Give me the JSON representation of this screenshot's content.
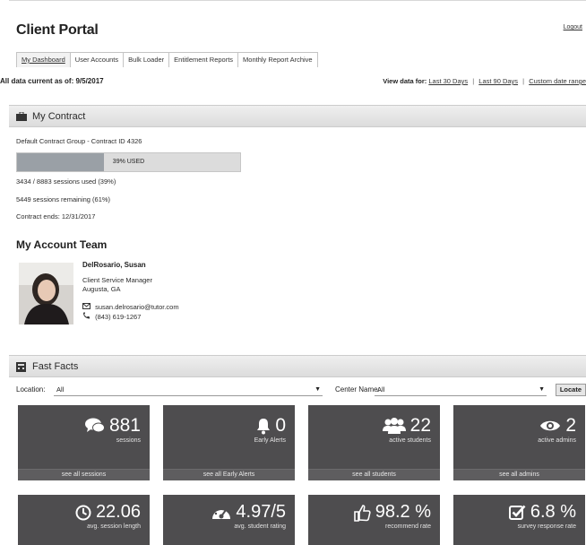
{
  "app": {
    "title": "Client Portal",
    "logout_label": "Logout"
  },
  "tabs": [
    {
      "label": "My Dashboard",
      "active": true
    },
    {
      "label": "User Accounts"
    },
    {
      "label": "Bulk Loader"
    },
    {
      "label": "Entitlement Reports"
    },
    {
      "label": "Monthly Report Archive"
    }
  ],
  "data_current": "All data current as of: 9/5/2017",
  "view_data": {
    "label": "View data for:",
    "options": [
      "Last 30 Days",
      "Last 90 Days",
      "Custom date range"
    ]
  },
  "contract": {
    "header": "My Contract",
    "group_line": "Default Contract Group - Contract ID 4326",
    "progress_label": "39% USED",
    "progress_fraction": 0.39,
    "sessions_used": "3434 / 8883 sessions used (39%)",
    "sessions_remaining": "5449 sessions remaining (61%)",
    "contract_ends": "Contract ends: 12/31/2017"
  },
  "team": {
    "title": "My Account Team",
    "name": "DelRosario, Susan",
    "role": "Client Service Manager",
    "location": "Augusta, GA",
    "email": "susan.delrosario@tutor.com",
    "phone": "(843) 619-1267"
  },
  "fast_facts": {
    "header": "Fast Facts",
    "location_label": "Location:",
    "location_value": "All",
    "center_label": "Center Name:",
    "center_value": "All",
    "locate_label": "Locate",
    "tiles_row1": [
      {
        "value": "881",
        "caption": "sessions",
        "footer": "see all sessions",
        "icon": "comments-icon"
      },
      {
        "value": "0",
        "caption": "Early Alerts",
        "footer": "see all Early Alerts",
        "icon": "bell-icon"
      },
      {
        "value": "22",
        "caption": "active students",
        "footer": "see all students",
        "icon": "users-icon"
      },
      {
        "value": "2",
        "caption": "active admins",
        "footer": "see all admins",
        "icon": "eye-icon"
      }
    ],
    "tiles_row2": [
      {
        "value": "22.06",
        "caption": "avg. session length",
        "icon": "clock-icon"
      },
      {
        "value": "4.97/5",
        "caption": "avg. student rating",
        "icon": "dashboard-icon"
      },
      {
        "value": "98.2 %",
        "caption": "recommend rate",
        "icon": "thumbs-up-icon"
      },
      {
        "value": "6.8 %",
        "caption": "survey response rate",
        "icon": "check-square-icon"
      }
    ]
  }
}
